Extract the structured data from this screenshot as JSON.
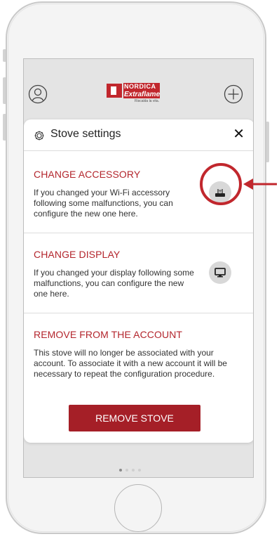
{
  "brand": {
    "name_top": "NORDICA",
    "name_bottom": "Extraflame",
    "tagline": "Riscalda la vita."
  },
  "modal": {
    "title": "Stove settings",
    "close_glyph": "✕"
  },
  "sections": [
    {
      "title": "CHANGE ACCESSORY",
      "text": "If you changed your Wi-Fi accessory following some malfunctions, you can configure the new one here.",
      "icon": "router-icon"
    },
    {
      "title": "CHANGE DISPLAY",
      "text": "If you changed your display following some malfunctions, you can configure the new one here.",
      "icon": "monitor-icon"
    },
    {
      "title": "REMOVE FROM THE ACCOUNT",
      "text": "This stove will no longer be associated with your account. To associate it with a new account it will be necessary to repeat the configuration procedure.",
      "button_label": "REMOVE STOVE"
    }
  ],
  "pager": {
    "pages": 4,
    "current": 1
  },
  "colors": {
    "accent": "#b3252c",
    "button": "#a51f27",
    "highlight": "#c1272d"
  }
}
